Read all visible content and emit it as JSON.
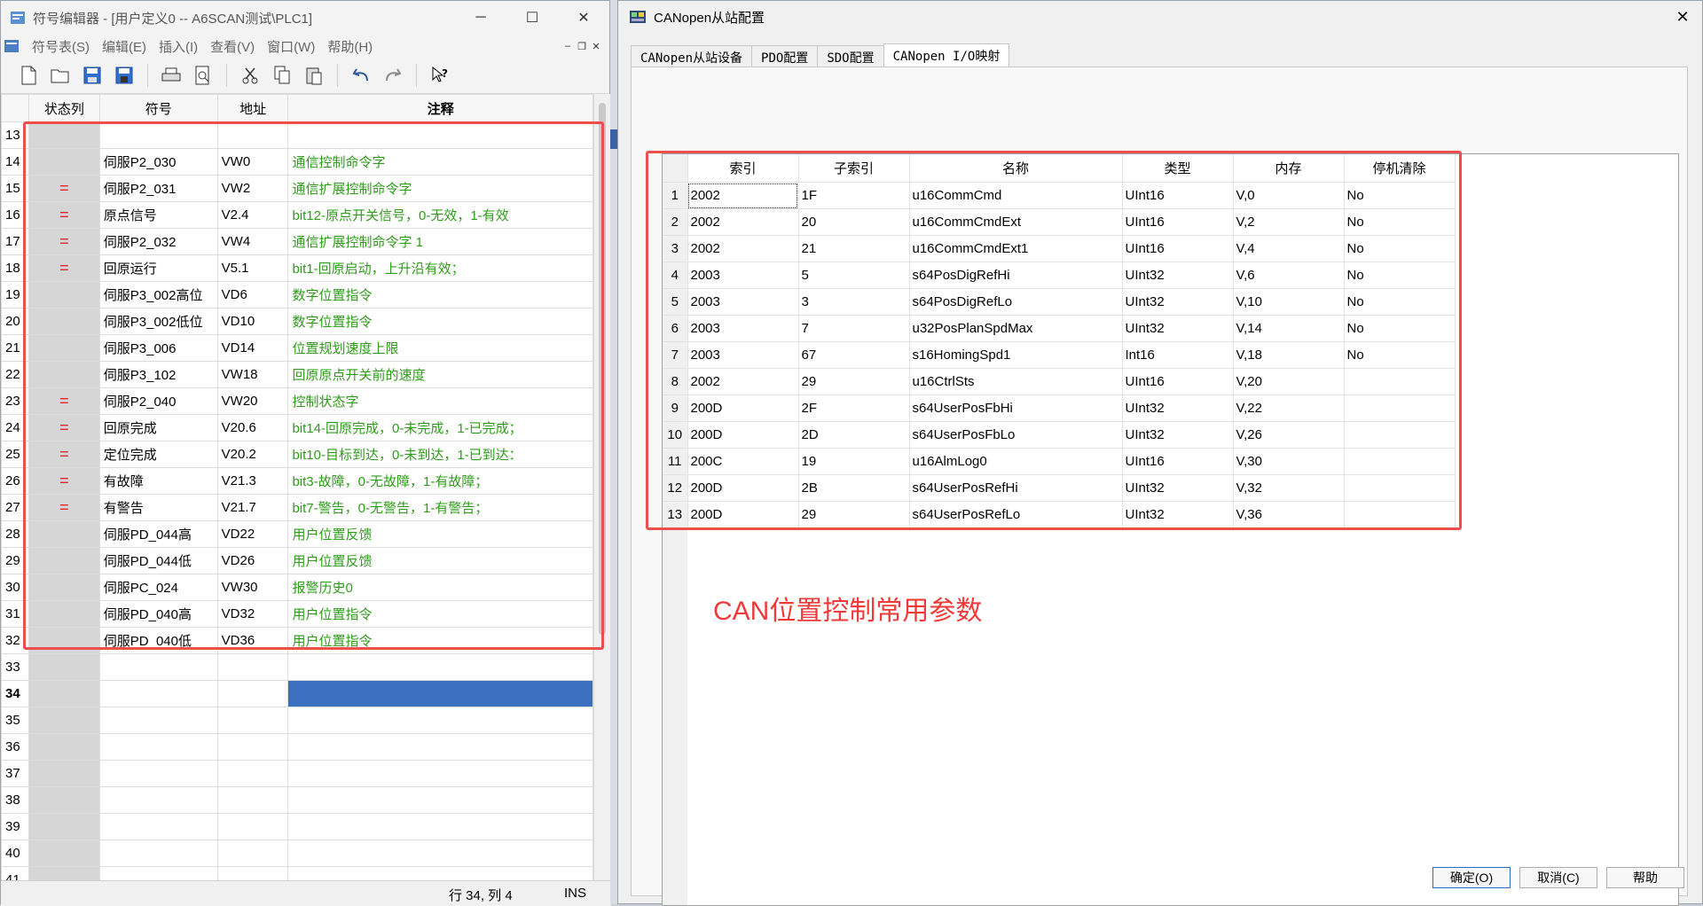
{
  "left_window": {
    "title": "符号编辑器 - [用户定义0 -- A6SCAN测试\\PLC1]",
    "menu": [
      "符号表(S)",
      "编辑(E)",
      "插入(I)",
      "查看(V)",
      "窗口(W)",
      "帮助(H)"
    ],
    "toolbar_icons": [
      "new-file-icon",
      "open-folder-icon",
      "save-icon",
      "save-all-icon",
      "print-icon",
      "print-preview-icon",
      "cut-icon",
      "copy-icon",
      "paste-icon",
      "undo-icon",
      "redo-icon",
      "context-help-icon"
    ],
    "columns": [
      "状态列",
      "符号",
      "地址",
      "注释"
    ],
    "rows": [
      {
        "n": "13",
        "status": "",
        "symbol": "",
        "address": "",
        "comment": ""
      },
      {
        "n": "14",
        "status": "",
        "symbol": "伺服P2_030",
        "address": "VW0",
        "comment": "通信控制命令字"
      },
      {
        "n": "15",
        "status": "=",
        "symbol": "伺服P2_031",
        "address": "VW2",
        "comment": "通信扩展控制命令字"
      },
      {
        "n": "16",
        "status": "=",
        "symbol": "原点信号",
        "address": "V2.4",
        "comment": "bit12-原点开关信号，0-无效，1-有效"
      },
      {
        "n": "17",
        "status": "=",
        "symbol": "伺服P2_032",
        "address": "VW4",
        "comment": "通信扩展控制命令字 1"
      },
      {
        "n": "18",
        "status": "=",
        "symbol": "回原运行",
        "address": "V5.1",
        "comment": "bit1-回原启动，上升沿有效；"
      },
      {
        "n": "19",
        "status": "",
        "symbol": "伺服P3_002高位",
        "address": "VD6",
        "comment": "数字位置指令"
      },
      {
        "n": "20",
        "status": "",
        "symbol": "伺服P3_002低位",
        "address": "VD10",
        "comment": "数字位置指令"
      },
      {
        "n": "21",
        "status": "",
        "symbol": "伺服P3_006",
        "address": "VD14",
        "comment": "位置规划速度上限"
      },
      {
        "n": "22",
        "status": "",
        "symbol": "伺服P3_102",
        "address": "VW18",
        "comment": "回原原点开关前的速度"
      },
      {
        "n": "23",
        "status": "=",
        "symbol": "伺服P2_040",
        "address": "VW20",
        "comment": "控制状态字"
      },
      {
        "n": "24",
        "status": "=",
        "symbol": "回原完成",
        "address": "V20.6",
        "comment": "bit14-回原完成，0-未完成，1-已完成；"
      },
      {
        "n": "25",
        "status": "=",
        "symbol": "定位完成",
        "address": "V20.2",
        "comment": "bit10-目标到达，0-未到达，1-已到达："
      },
      {
        "n": "26",
        "status": "=",
        "symbol": "有故障",
        "address": "V21.3",
        "comment": "bit3-故障，0-无故障，1-有故障；"
      },
      {
        "n": "27",
        "status": "=",
        "symbol": "有警告",
        "address": "V21.7",
        "comment": "bit7-警告，0-无警告，1-有警告；"
      },
      {
        "n": "28",
        "status": "",
        "symbol": "伺服PD_044高",
        "address": "VD22",
        "comment": "用户位置反馈"
      },
      {
        "n": "29",
        "status": "",
        "symbol": "伺服PD_044低",
        "address": "VD26",
        "comment": "用户位置反馈"
      },
      {
        "n": "30",
        "status": "",
        "symbol": "伺服PC_024",
        "address": "VW30",
        "comment": "报警历史0"
      },
      {
        "n": "31",
        "status": "",
        "symbol": "伺服PD_040高",
        "address": "VD32",
        "comment": "用户位置指令"
      },
      {
        "n": "32",
        "status": "",
        "symbol": "伺服PD_040低",
        "address": "VD36",
        "comment": "用户位置指令"
      },
      {
        "n": "33",
        "status": "",
        "symbol": "",
        "address": "",
        "comment": ""
      },
      {
        "n": "34",
        "status": "",
        "symbol": "",
        "address": "",
        "comment": "",
        "selected": true
      },
      {
        "n": "35",
        "status": "",
        "symbol": "",
        "address": "",
        "comment": ""
      },
      {
        "n": "36",
        "status": "",
        "symbol": "",
        "address": "",
        "comment": ""
      },
      {
        "n": "37",
        "status": "",
        "symbol": "",
        "address": "",
        "comment": ""
      },
      {
        "n": "38",
        "status": "",
        "symbol": "",
        "address": "",
        "comment": ""
      },
      {
        "n": "39",
        "status": "",
        "symbol": "",
        "address": "",
        "comment": ""
      },
      {
        "n": "40",
        "status": "",
        "symbol": "",
        "address": "",
        "comment": ""
      },
      {
        "n": "41",
        "status": "",
        "symbol": "",
        "address": "",
        "comment": ""
      }
    ],
    "status": {
      "position": "行 34, 列 4",
      "mode": "INS"
    }
  },
  "right_window": {
    "title": "CANopen从站配置",
    "close": "✕",
    "tabs": [
      "CANopen从站设备",
      "PDO配置",
      "SDO配置",
      "CANopen I/O映射"
    ],
    "active_tab": 3,
    "columns": [
      "索引",
      "子索引",
      "名称",
      "类型",
      "内存",
      "停机清除"
    ],
    "rows": [
      {
        "n": "1",
        "index": "2002",
        "sub": "1F",
        "name": "u16CommCmd",
        "type": "UInt16",
        "mem": "V,0",
        "clear": "No"
      },
      {
        "n": "2",
        "index": "2002",
        "sub": "20",
        "name": "u16CommCmdExt",
        "type": "UInt16",
        "mem": "V,2",
        "clear": "No"
      },
      {
        "n": "3",
        "index": "2002",
        "sub": "21",
        "name": "u16CommCmdExt1",
        "type": "UInt16",
        "mem": "V,4",
        "clear": "No"
      },
      {
        "n": "4",
        "index": "2003",
        "sub": "5",
        "name": "s64PosDigRefHi",
        "type": "UInt32",
        "mem": "V,6",
        "clear": "No"
      },
      {
        "n": "5",
        "index": "2003",
        "sub": "3",
        "name": "s64PosDigRefLo",
        "type": "UInt32",
        "mem": "V,10",
        "clear": "No"
      },
      {
        "n": "6",
        "index": "2003",
        "sub": "7",
        "name": "u32PosPlanSpdMax",
        "type": "UInt32",
        "mem": "V,14",
        "clear": "No"
      },
      {
        "n": "7",
        "index": "2003",
        "sub": "67",
        "name": "s16HomingSpd1",
        "type": "Int16",
        "mem": "V,18",
        "clear": "No"
      },
      {
        "n": "8",
        "index": "2002",
        "sub": "29",
        "name": "u16CtrlSts",
        "type": "UInt16",
        "mem": "V,20",
        "clear": ""
      },
      {
        "n": "9",
        "index": "200D",
        "sub": "2F",
        "name": "s64UserPosFbHi",
        "type": "UInt32",
        "mem": "V,22",
        "clear": ""
      },
      {
        "n": "10",
        "index": "200D",
        "sub": "2D",
        "name": "s64UserPosFbLo",
        "type": "UInt32",
        "mem": "V,26",
        "clear": ""
      },
      {
        "n": "11",
        "index": "200C",
        "sub": "19",
        "name": "u16AlmLog0",
        "type": "UInt16",
        "mem": "V,30",
        "clear": ""
      },
      {
        "n": "12",
        "index": "200D",
        "sub": "2B",
        "name": "s64UserPosRefHi",
        "type": "UInt32",
        "mem": "V,32",
        "clear": ""
      },
      {
        "n": "13",
        "index": "200D",
        "sub": "29",
        "name": "s64UserPosRefLo",
        "type": "UInt32",
        "mem": "V,36",
        "clear": ""
      }
    ],
    "annotation": "CAN位置控制常用参数",
    "buttons": {
      "ok": "确定(O)",
      "cancel": "取消(C)",
      "help": "帮助"
    }
  },
  "colors": {
    "annotation_red": "#ef4e4e",
    "comment_green": "#2e9c1a",
    "selection_blue": "#3b6fc0"
  }
}
